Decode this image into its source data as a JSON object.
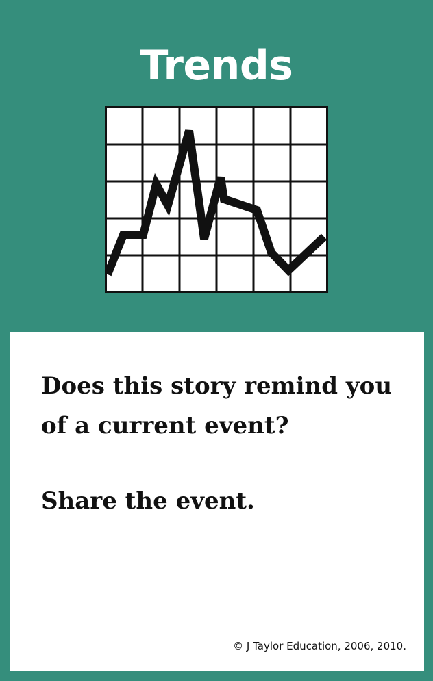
{
  "card": {
    "title": "Trends",
    "prompt": "Does this story remind you of a current event?",
    "action": "Share the event.",
    "copyright": "© J Taylor Education, 2006, 2010."
  },
  "icon": {
    "name": "line-chart-icon"
  },
  "colors": {
    "background": "#358e7c",
    "panel": "#ffffff",
    "text": "#111111",
    "title": "#ffffff"
  }
}
